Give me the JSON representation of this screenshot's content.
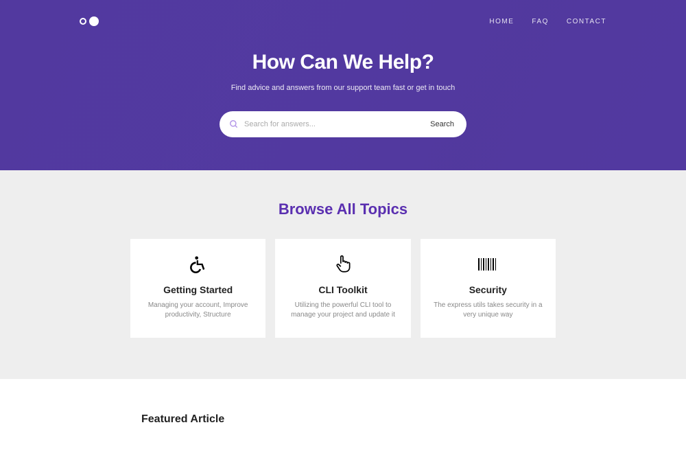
{
  "nav": {
    "links": [
      "HOME",
      "FAQ",
      "CONTACT"
    ]
  },
  "hero": {
    "title": "How Can We Help?",
    "subtitle": "Find advice and answers from our support team fast or get in touch"
  },
  "search": {
    "placeholder": "Search for answers...",
    "button": "Search"
  },
  "topics": {
    "heading": "Browse All Topics",
    "cards": [
      {
        "title": "Getting Started",
        "desc": "Managing your account, Improve productivity, Structure"
      },
      {
        "title": "CLI Toolkit",
        "desc": "Utilizing the powerful CLI tool to manage your project and update it"
      },
      {
        "title": "Security",
        "desc": "The express utils takes security in a very unique way"
      }
    ]
  },
  "featured": {
    "heading": "Featured Article"
  }
}
